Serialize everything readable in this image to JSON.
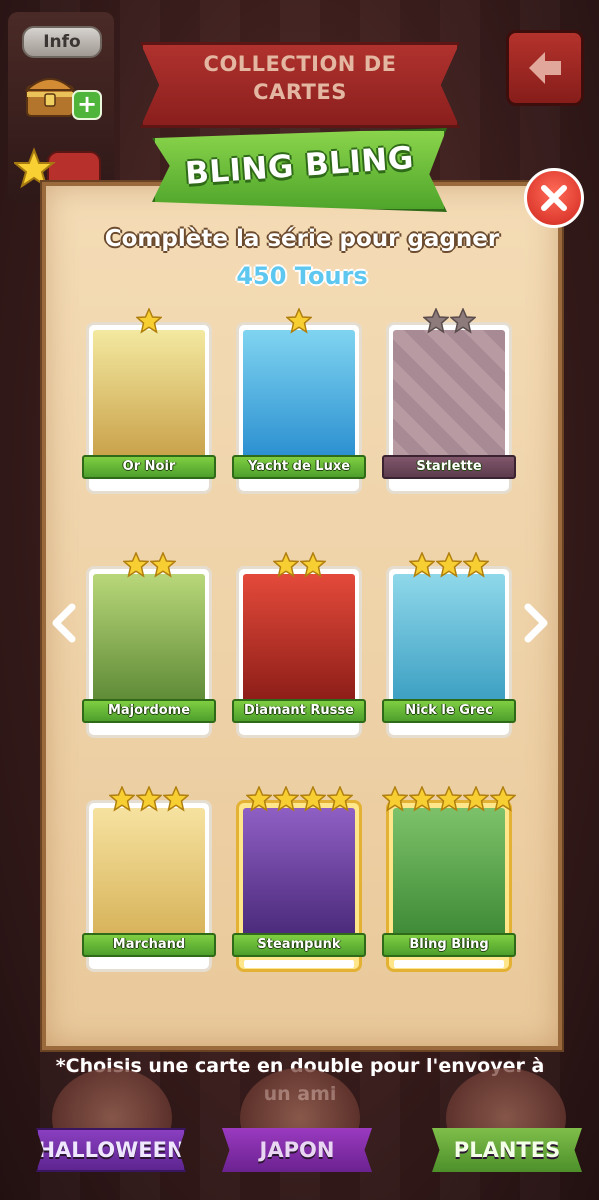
{
  "header": {
    "info_label": "Info",
    "collection_title_line1": "COLLECTION DE",
    "collection_title_line2": "CARTES"
  },
  "set": {
    "title": "BLING BLING",
    "subtitle": "Complète la série pour gagner",
    "reward": "450 Tours"
  },
  "cards": [
    {
      "name": "Or Noir",
      "stars": 1,
      "owned": true,
      "gold": false
    },
    {
      "name": "Yacht de Luxe",
      "stars": 1,
      "owned": true,
      "gold": false
    },
    {
      "name": "Starlette",
      "stars": 2,
      "owned": false,
      "gold": false
    },
    {
      "name": "Majordome",
      "stars": 2,
      "owned": true,
      "gold": false
    },
    {
      "name": "Diamant Russe",
      "stars": 2,
      "owned": true,
      "gold": false
    },
    {
      "name": "Nick le Grec",
      "stars": 3,
      "owned": true,
      "gold": false
    },
    {
      "name": "Marchand",
      "stars": 3,
      "owned": true,
      "gold": false
    },
    {
      "name": "Steampunk",
      "stars": 4,
      "owned": true,
      "gold": true
    },
    {
      "name": "Bling Bling",
      "stars": 5,
      "owned": true,
      "gold": true
    }
  ],
  "footer": {
    "note": "*Choisis une carte en double pour l'envoyer à un ami"
  },
  "bottom_tabs": [
    {
      "label": "HALLOWEEN"
    },
    {
      "label": "JAPON"
    },
    {
      "label": "PLANTES"
    }
  ],
  "colors": {
    "accent_green": "#4fa52b",
    "reward_blue": "#5ec7f0",
    "close_red": "#d0271f",
    "locked_label": "#5c3b4d",
    "gold_frame": "#e3b234"
  },
  "icons": {
    "back": "back-arrow-icon",
    "close": "close-icon",
    "prev": "chevron-left-icon",
    "next": "chevron-right-icon",
    "chest": "treasure-chest-icon",
    "star": "star-icon"
  }
}
